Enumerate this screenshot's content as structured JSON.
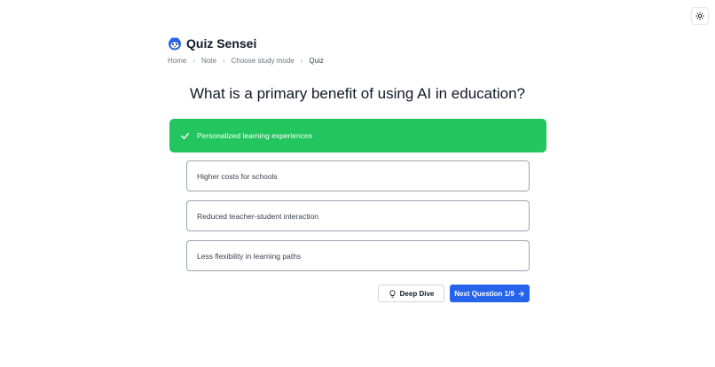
{
  "app": {
    "brand_name": "Quiz Sensei",
    "logo_icon": "fox-logo-icon",
    "theme_toggle_icon": "sun-icon"
  },
  "breadcrumb": [
    {
      "label": "Home"
    },
    {
      "label": "Note"
    },
    {
      "label": "Choose study mode"
    },
    {
      "label": "Quiz"
    }
  ],
  "quiz": {
    "question": "What is a primary benefit of using AI in education?",
    "options": [
      {
        "label": "Personalized learning experiences",
        "state": "correct"
      },
      {
        "label": "Higher costs for schools",
        "state": "default"
      },
      {
        "label": "Reduced teacher-student interaction",
        "state": "default"
      },
      {
        "label": "Less flexibility in learning paths",
        "state": "default"
      }
    ]
  },
  "actions": {
    "deep_dive_label": "Deep Dive",
    "deep_dive_icon": "lightbulb-icon",
    "next_label": "Next Question 1/9",
    "next_icon": "arrow-right-icon"
  },
  "colors": {
    "correct": "#22c55e",
    "primary": "#2563eb"
  }
}
